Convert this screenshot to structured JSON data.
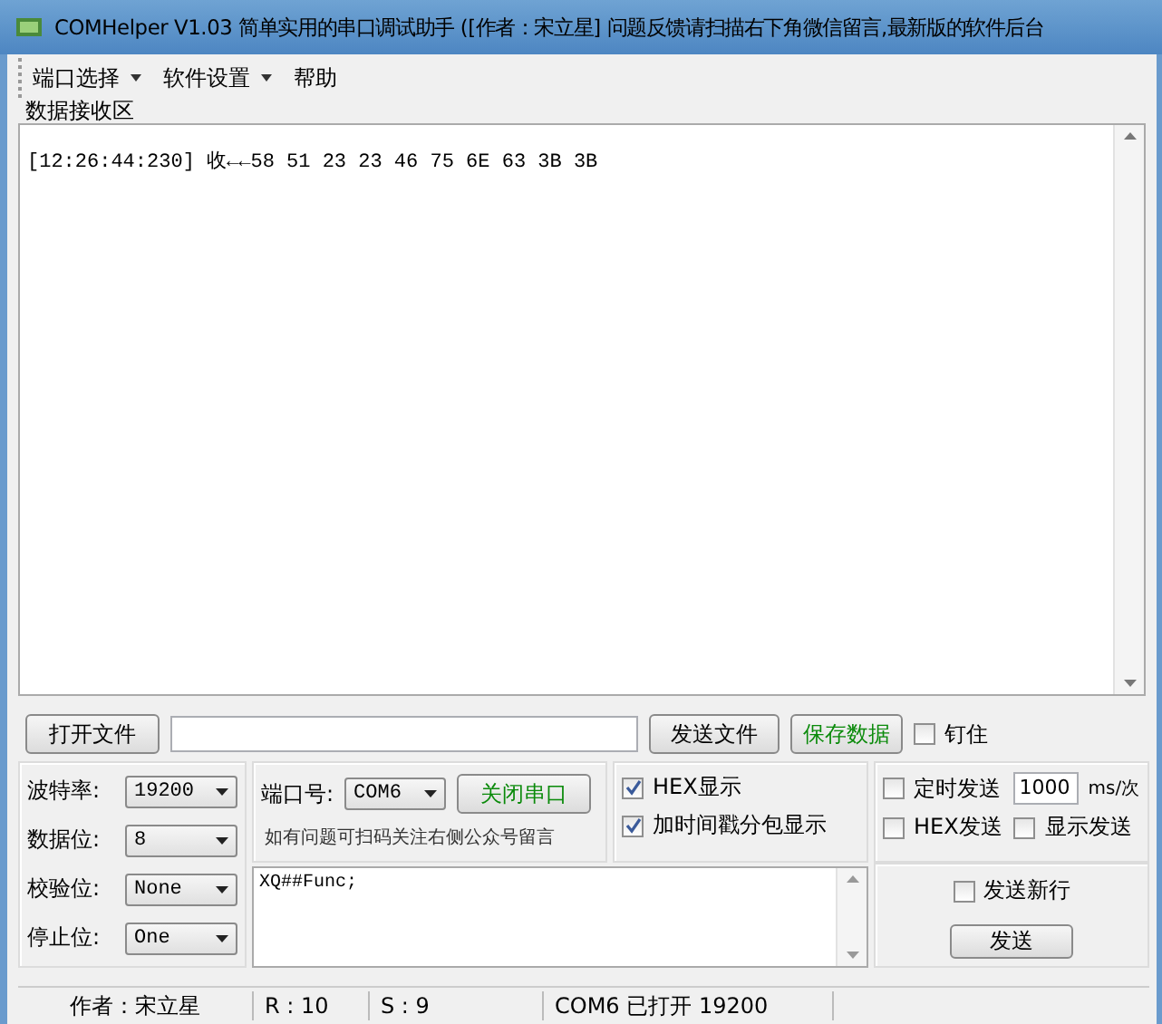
{
  "window": {
    "title": "COMHelper V1.03 简单实用的串口调试助手 ([作者：宋立星] 问题反馈请扫描右下角微信留言,最新版的软件后台"
  },
  "menu": [
    {
      "label": "端口选择",
      "dropdown": true
    },
    {
      "label": "软件设置",
      "dropdown": true
    },
    {
      "label": "帮助",
      "dropdown": false
    }
  ],
  "receive": {
    "group_label": "数据接收区",
    "lines": [
      "[12:26:44:230] 收←←58 51 23 23 46 75 6E 63 3B 3B"
    ]
  },
  "file_row": {
    "open_button": "打开文件",
    "send_file_button": "发送文件",
    "save_button": "保存数据",
    "pin": {
      "label": "钉住",
      "checked": false
    }
  },
  "serial_settings": [
    {
      "label": "波特率:",
      "value": "19200"
    },
    {
      "label": "数据位:",
      "value": "8"
    },
    {
      "label": "校验位:",
      "value": "None"
    },
    {
      "label": "停止位:",
      "value": "One"
    }
  ],
  "port": {
    "label": "端口号:",
    "value": "COM6",
    "toggle_button": "关闭串口",
    "hint": "如有问题可扫码关注右侧公众号留言"
  },
  "display_options": [
    {
      "label": "HEX显示",
      "checked": true
    },
    {
      "label": "加时间戳分包显示",
      "checked": true
    }
  ],
  "send_options": {
    "timed": {
      "label": "定时发送",
      "checked": false
    },
    "interval": "1000",
    "unit": "ms/次",
    "hex_send": {
      "label": "HEX发送",
      "checked": false
    },
    "show_send": {
      "label": "显示发送",
      "checked": false
    }
  },
  "send": {
    "text": "XQ##Func;",
    "newline": {
      "label": "发送新行",
      "checked": false
    },
    "button": "发送"
  },
  "status_bar": [
    "作者：宋立星",
    "R : 10",
    "S : 9",
    "COM6 已打开 19200"
  ]
}
